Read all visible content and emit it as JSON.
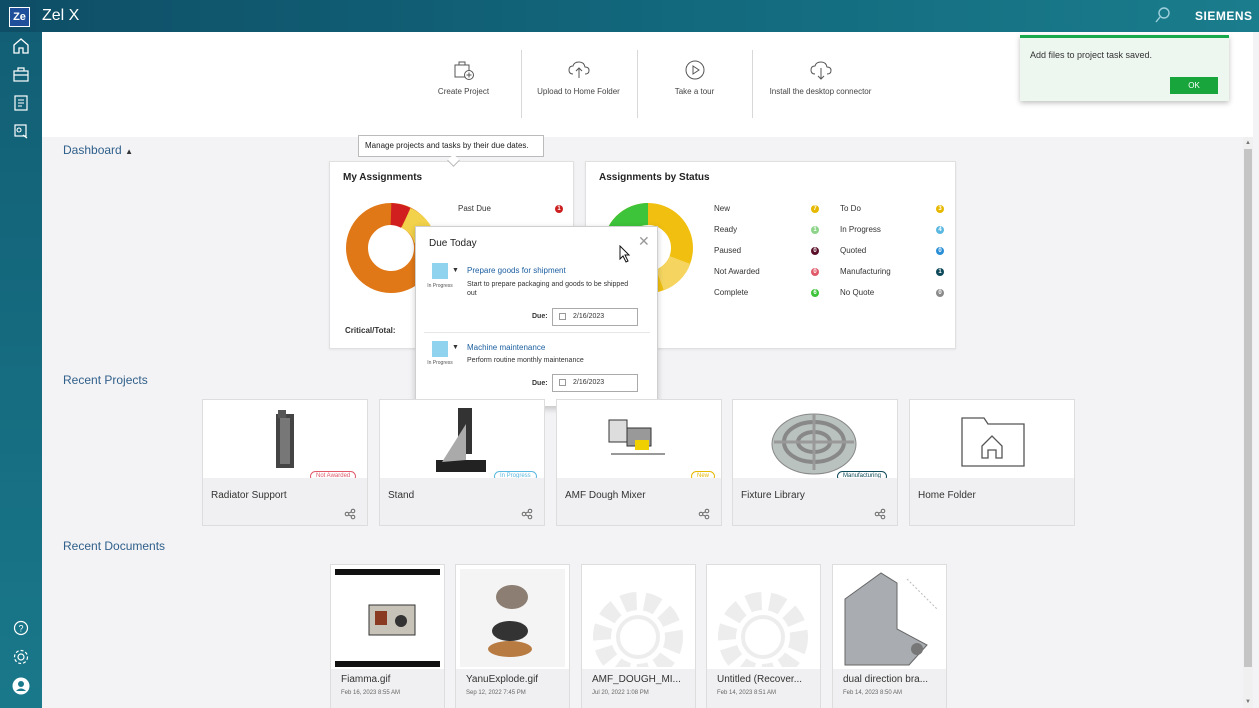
{
  "app": {
    "logo": "Ze",
    "title": "Zel X",
    "brand": "SIEMENS"
  },
  "leftrail": {
    "icons": [
      "home-icon",
      "briefcase-icon",
      "tasks-icon",
      "assignments-icon",
      "help-icon",
      "settings-icon",
      "user-icon"
    ]
  },
  "actions": [
    {
      "label": "Create Project",
      "icon": "create-project-icon"
    },
    {
      "label": "Upload to Home Folder",
      "icon": "upload-cloud-icon"
    },
    {
      "label": "Take a tour",
      "icon": "play-icon"
    },
    {
      "label": "Install the desktop connector",
      "icon": "install-connector-icon"
    }
  ],
  "dashboard": {
    "label": "Dashboard",
    "tooltip": "Manage projects and tasks by their due dates.",
    "my_assignments": {
      "title": "My Assignments",
      "legend": [
        {
          "label": "Past Due",
          "count": "1",
          "color": "#cc1f1f"
        }
      ],
      "footer": "Critical/Total:"
    },
    "by_status": {
      "title": "Assignments by Status",
      "left": [
        {
          "label": "New",
          "count": "7",
          "color": "#e6b800"
        },
        {
          "label": "Ready",
          "count": "1",
          "color": "#8dd48a"
        },
        {
          "label": "Paused",
          "count": "0",
          "color": "#5a1028"
        },
        {
          "label": "Not Awarded",
          "count": "0",
          "color": "#e05a6a"
        },
        {
          "label": "Complete",
          "count": "6",
          "color": "#3ec43a"
        }
      ],
      "right": [
        {
          "label": "To Do",
          "count": "3",
          "color": "#e6b800"
        },
        {
          "label": "In Progress",
          "count": "4",
          "color": "#5bb8e0"
        },
        {
          "label": "Quoted",
          "count": "0",
          "color": "#2a8fd6"
        },
        {
          "label": "Manufacturing",
          "count": "1",
          "color": "#0f4a5a"
        },
        {
          "label": "No Quote",
          "count": "0",
          "color": "#8a8a8a"
        }
      ]
    }
  },
  "due_today": {
    "title": "Due Today",
    "due_label": "Due:",
    "tasks": [
      {
        "status": "In Progress",
        "title": "Prepare goods for shipment",
        "desc": "Start to prepare packaging and goods to be shipped out",
        "due": "2/16/2023"
      },
      {
        "status": "In Progress",
        "title": "Machine maintenance",
        "desc": "Perform routine monthly maintenance",
        "due": "2/16/2023"
      }
    ]
  },
  "recent_projects": {
    "label": "Recent Projects",
    "items": [
      {
        "name": "Radiator Support",
        "badge": "Not Awarded",
        "badge_color": "#e05a6a"
      },
      {
        "name": "Stand",
        "badge": "In Progress",
        "badge_color": "#5bb8e0"
      },
      {
        "name": "AMF Dough Mixer",
        "badge": "New",
        "badge_color": "#e6b800"
      },
      {
        "name": "Fixture Library",
        "badge": "Manufacturing",
        "badge_color": "#0f4a5a"
      },
      {
        "name": "Home Folder",
        "badge": "",
        "badge_color": ""
      }
    ]
  },
  "recent_documents": {
    "label": "Recent Documents",
    "items": [
      {
        "name": "Fiamma.gif",
        "date": "Feb 16, 2023 8:55 AM"
      },
      {
        "name": "YanuExplode.gif",
        "date": "Sep 12, 2022 7:45 PM"
      },
      {
        "name": "AMF_DOUGH_MI...",
        "date": "Jul 20, 2022 1:08 PM"
      },
      {
        "name": "Untitled (Recover...",
        "date": "Feb 14, 2023 8:51 AM"
      },
      {
        "name": "dual direction bra...",
        "date": "Feb 14, 2023 8:50 AM"
      }
    ]
  },
  "toast": {
    "message": "Add files to project task saved.",
    "ok": "OK"
  }
}
